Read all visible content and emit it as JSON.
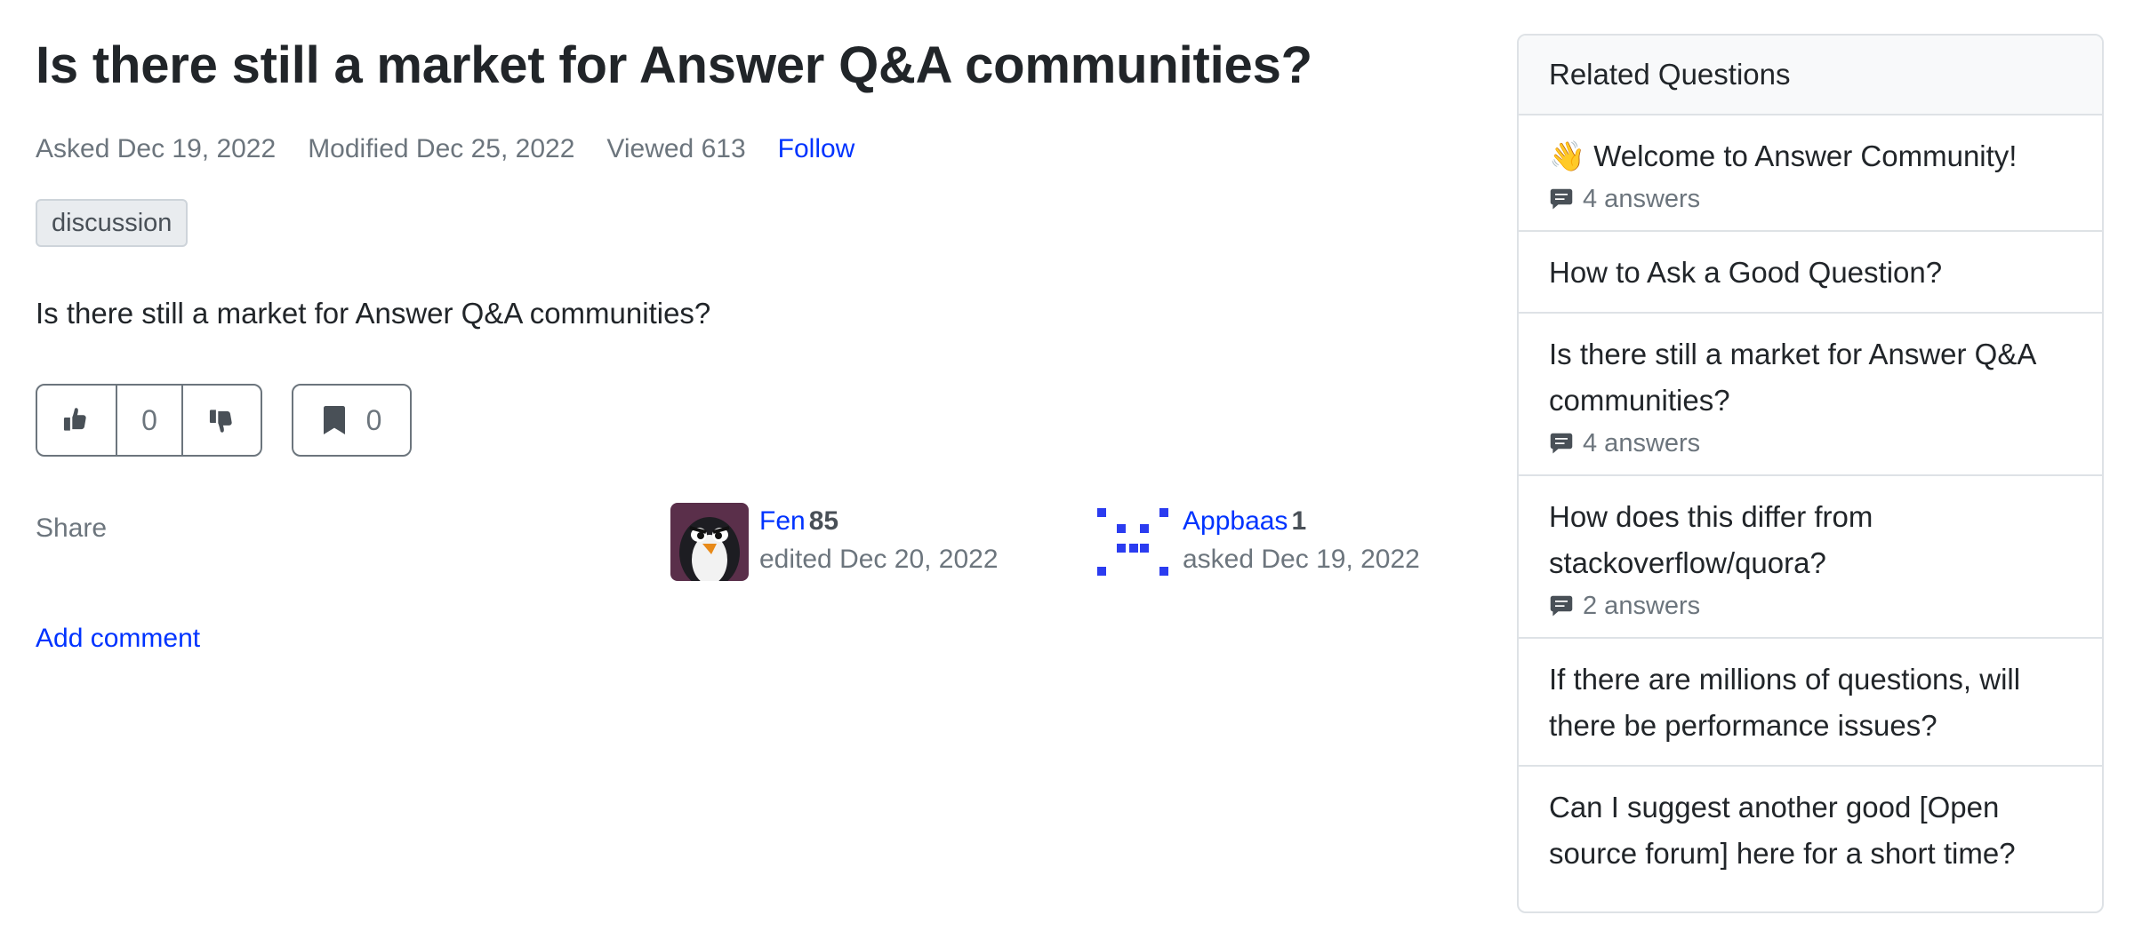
{
  "question": {
    "title": "Is there still a market for Answer Q&A communities?",
    "meta": {
      "asked": "Asked Dec 19, 2022",
      "modified": "Modified Dec 25, 2022",
      "viewed": "Viewed 613",
      "follow": "Follow"
    },
    "tags": [
      "discussion"
    ],
    "body": "Is there still a market for Answer Q&A communities?",
    "votes": "0",
    "bookmarks": "0",
    "share_label": "Share",
    "add_comment_label": "Add comment",
    "editor": {
      "name": "Fen",
      "reputation": "85",
      "action": "edited Dec 20, 2022"
    },
    "asker": {
      "name": "Appbaas",
      "reputation": "1",
      "action": "asked Dec 19, 2022"
    }
  },
  "related": {
    "header": "Related Questions",
    "items": [
      {
        "title": "👋 Welcome to Answer Community!",
        "answers": "4 answers"
      },
      {
        "title": "How to Ask a Good Question?",
        "answers": ""
      },
      {
        "title": "Is there still a market for Answer Q&A communities?",
        "answers": "4 answers"
      },
      {
        "title": "How does this differ from stackoverflow/quora?",
        "answers": "2 answers"
      },
      {
        "title": "If there are millions of questions, will there be performance issues?",
        "answers": ""
      },
      {
        "title": "Can I suggest another good [Open source forum] here for a short time?",
        "answers": ""
      }
    ]
  },
  "colors": {
    "link": "#0033ff",
    "text": "#212529",
    "muted": "#6c757d",
    "border": "#dee2e6"
  }
}
